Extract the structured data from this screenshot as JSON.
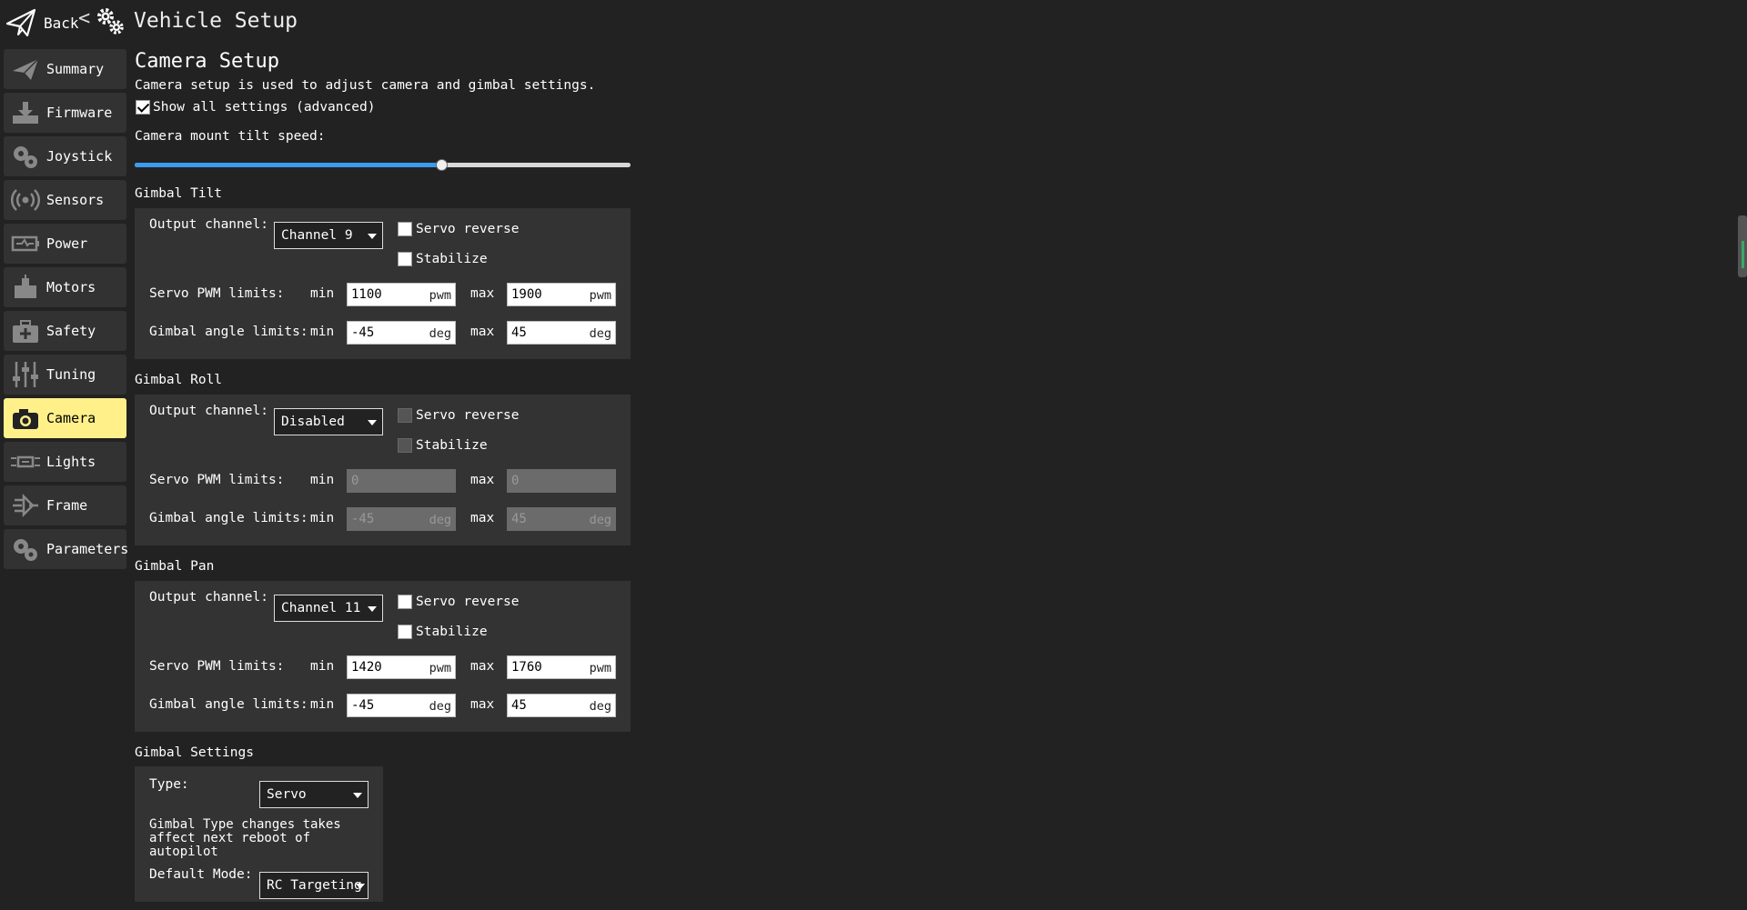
{
  "header": {
    "back_label": "Back",
    "chevron": "<",
    "title": "Vehicle Setup",
    "icons": {
      "back": "paper-plane-icon",
      "title": "gears-icon"
    }
  },
  "sidebar": {
    "items": [
      {
        "label": "Summary",
        "icon": "paper-plane-icon",
        "active": false
      },
      {
        "label": "Firmware",
        "icon": "download-icon",
        "active": false
      },
      {
        "label": "Joystick",
        "icon": "gears-icon",
        "active": false
      },
      {
        "label": "Sensors",
        "icon": "radio-waves-icon",
        "active": false
      },
      {
        "label": "Power",
        "icon": "battery-icon",
        "active": false
      },
      {
        "label": "Motors",
        "icon": "motor-icon",
        "active": false
      },
      {
        "label": "Safety",
        "icon": "first-aid-kit-icon",
        "active": false
      },
      {
        "label": "Tuning",
        "icon": "sliders-icon",
        "active": false
      },
      {
        "label": "Camera",
        "icon": "camera-icon",
        "active": true
      },
      {
        "label": "Lights",
        "icon": "lights-icon",
        "active": false
      },
      {
        "label": "Frame",
        "icon": "frame-icon",
        "active": false
      },
      {
        "label": "Parameters",
        "icon": "gears-icon",
        "active": false
      }
    ],
    "active_color": "#fff08a"
  },
  "main": {
    "title": "Camera Setup",
    "description": "Camera setup is used to adjust camera and gimbal settings.",
    "show_all_label": "Show all settings (advanced)",
    "show_all_checked": true,
    "tilt_speed_label": "Camera mount tilt speed:",
    "tilt_speed_fraction": 0.62,
    "accent_color": "#3a9bf0"
  },
  "labels": {
    "output_channel": "Output channel:",
    "servo_reverse": "Servo reverse",
    "stabilize": "Stabilize",
    "servo_pwm_limits": "Servo PWM limits:",
    "gimbal_angle_limits": "Gimbal angle limits:",
    "min": "min",
    "max": "max",
    "pwm": "pwm",
    "deg": "deg"
  },
  "gimbals": {
    "tilt": {
      "title": "Gimbal Tilt",
      "channel": "Channel 9",
      "enabled": true,
      "servo_reverse": false,
      "stabilize": false,
      "pwm_min": "1100",
      "pwm_max": "1900",
      "angle_min": "-45",
      "angle_max": "45"
    },
    "roll": {
      "title": "Gimbal Roll",
      "channel": "Disabled",
      "enabled": false,
      "servo_reverse": false,
      "stabilize": false,
      "pwm_min": "0",
      "pwm_max": "0",
      "angle_min": "-45",
      "angle_max": "45"
    },
    "pan": {
      "title": "Gimbal Pan",
      "channel": "Channel 11",
      "enabled": true,
      "servo_reverse": false,
      "stabilize": false,
      "pwm_min": "1420",
      "pwm_max": "1760",
      "angle_min": "-45",
      "angle_max": "45"
    }
  },
  "gimbal_settings": {
    "title": "Gimbal Settings",
    "type_label": "Type:",
    "type_value": "Servo",
    "note_line1": "Gimbal Type changes takes",
    "note_line2": "affect next reboot of",
    "note_line3": "autopilot",
    "default_mode_label": "Default Mode:",
    "default_mode_value": "RC Targeting"
  }
}
